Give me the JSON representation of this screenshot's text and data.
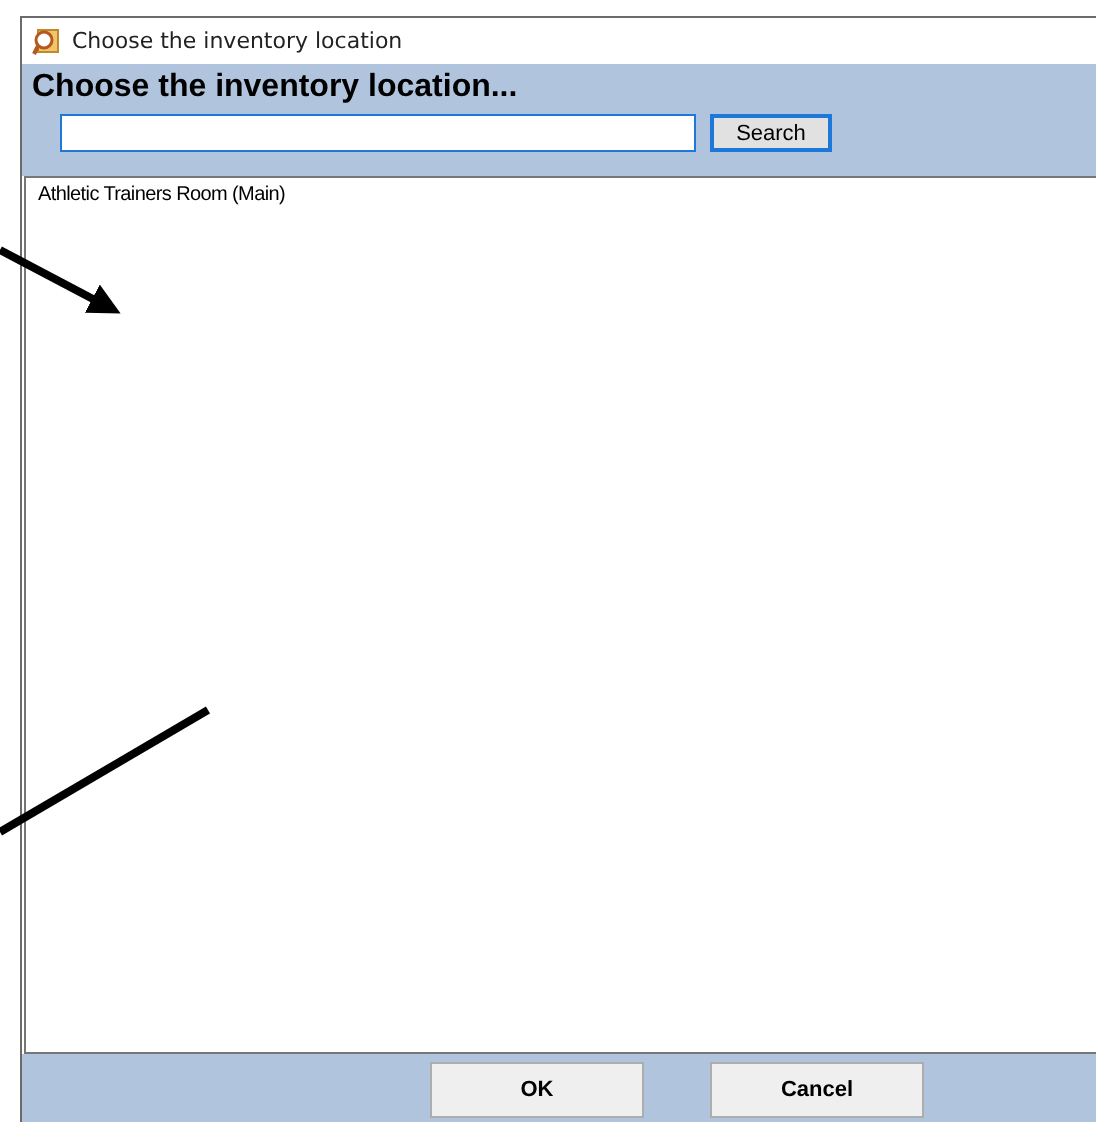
{
  "window": {
    "title": "Choose the inventory location"
  },
  "header": {
    "heading": "Choose the inventory location...",
    "search_button": "Search"
  },
  "locations": [
    {
      "label": "Athletic Trainers Room (Main)",
      "selected": false
    }
  ],
  "buttons": [
    {
      "label": "OK"
    },
    {
      "label": "Cancel"
    }
  ]
}
